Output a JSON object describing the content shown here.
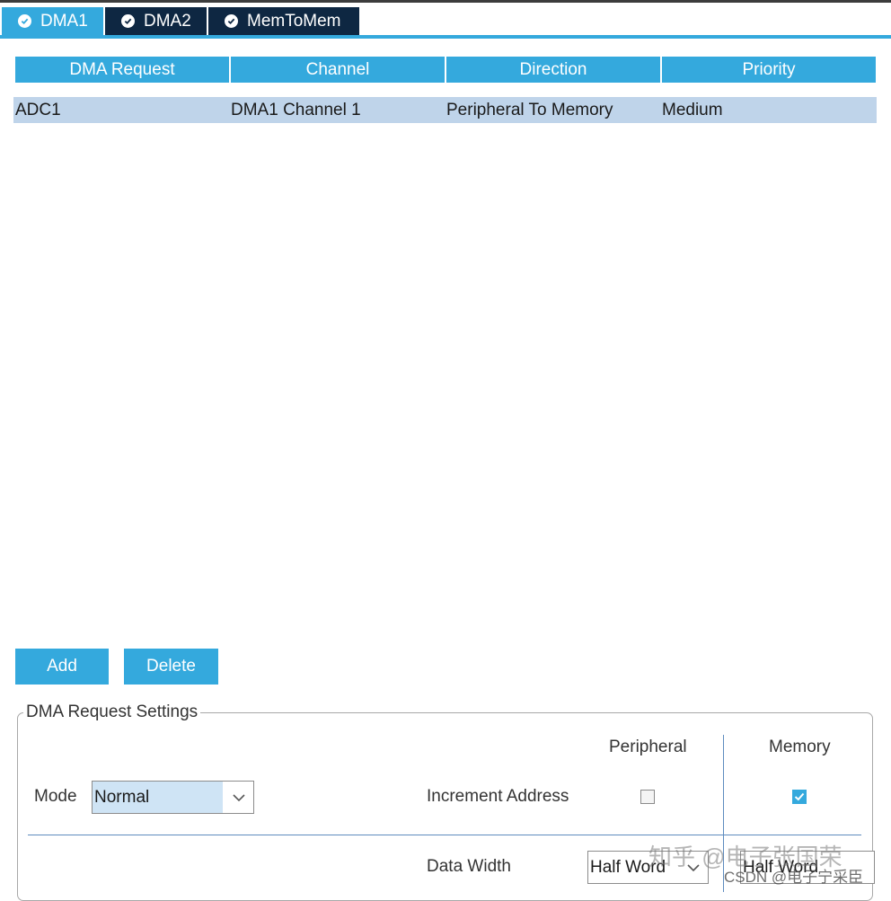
{
  "tabs": [
    {
      "label": "DMA1"
    },
    {
      "label": "DMA2"
    },
    {
      "label": "MemToMem"
    }
  ],
  "table": {
    "headers": [
      "DMA Request",
      "Channel",
      "Direction",
      "Priority"
    ],
    "rows": [
      [
        "ADC1",
        "DMA1 Channel 1",
        "Peripheral To Memory",
        "Medium"
      ]
    ]
  },
  "buttons": {
    "add": "Add",
    "delete": "Delete"
  },
  "settings": {
    "title": "DMA Request Settings",
    "mode_label": "Mode",
    "mode_value": "Normal",
    "col_peripheral": "Peripheral",
    "col_memory": "Memory",
    "increment_label": "Increment Address",
    "increment_peripheral_checked": false,
    "increment_memory_checked": true,
    "data_width_label": "Data Width",
    "data_width_peripheral": "Half Word",
    "data_width_memory": "Half Word"
  },
  "watermarks": {
    "zhihu": "知乎 @电子张国荣",
    "csdn": "CSDN @电子宁采臣"
  },
  "colors": {
    "accent": "#34a9dd",
    "tab_inactive": "#0e2742",
    "row_selected": "#bfd4ea"
  }
}
